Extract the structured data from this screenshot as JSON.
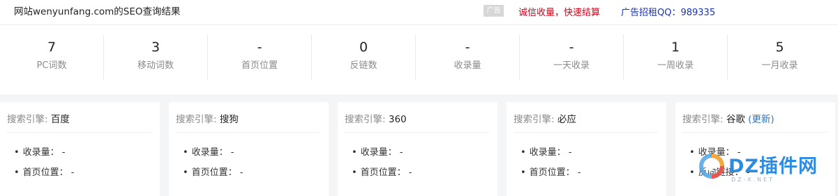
{
  "header": {
    "title": "网站wenyunfang.com的SEO查询结果",
    "ad_badge": "广告",
    "promo": "诚信收量，快速结算",
    "ad_contact": "广告招租QQ：989335"
  },
  "stats": [
    {
      "value": "7",
      "label": "PC词数"
    },
    {
      "value": "3",
      "label": "移动词数"
    },
    {
      "value": "-",
      "label": "首页位置"
    },
    {
      "value": "0",
      "label": "反链数"
    },
    {
      "value": "-",
      "label": "收录量"
    },
    {
      "value": "-",
      "label": "一天收录"
    },
    {
      "value": "1",
      "label": "一周收录"
    },
    {
      "value": "5",
      "label": "一月收录"
    }
  ],
  "engine_prefix": "搜索引擎:",
  "engines": [
    {
      "name": "百度",
      "items": [
        "收录量：  -",
        "首页位置：  -"
      ]
    },
    {
      "name": "搜狗",
      "items": [
        "收录量：  -",
        "首页位置：  -"
      ]
    },
    {
      "name": "360",
      "items": [
        "收录量：  -",
        "首页位置：  -"
      ]
    },
    {
      "name": "必应",
      "items": [
        "收录量：  -",
        "首页位置：  -"
      ]
    },
    {
      "name": "谷歌",
      "update": "(更新)",
      "items": [
        "收录量：  -",
        "反向链接：  -"
      ]
    }
  ],
  "watermark": {
    "text": "DZ插件网",
    "sub": "DZ-X.NET"
  },
  "colors": {
    "promo": "#d0021b",
    "ad_contact": "#1a32b8",
    "update_link": "#2a74c6",
    "watermark": "#2e8ce0"
  }
}
